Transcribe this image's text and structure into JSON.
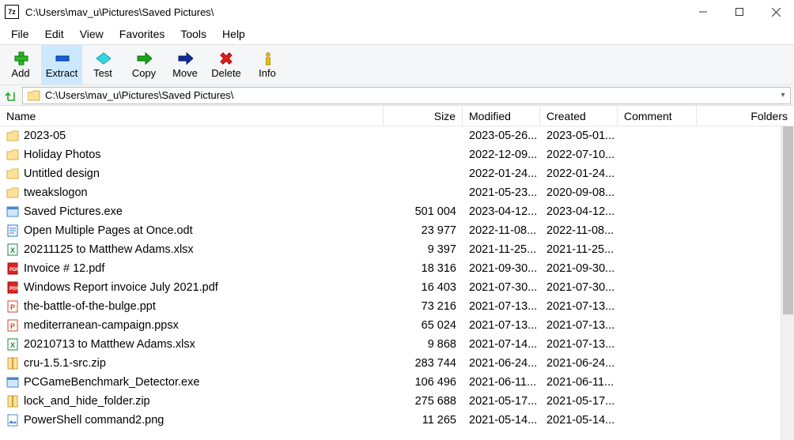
{
  "titlebar": {
    "path": "C:\\Users\\mav_u\\Pictures\\Saved Pictures\\"
  },
  "menu": [
    "File",
    "Edit",
    "View",
    "Favorites",
    "Tools",
    "Help"
  ],
  "toolbar": [
    {
      "id": "add",
      "label": "Add",
      "icon": "plus"
    },
    {
      "id": "extract",
      "label": "Extract",
      "icon": "minus",
      "selected": true
    },
    {
      "id": "test",
      "label": "Test",
      "icon": "test"
    },
    {
      "id": "copy",
      "label": "Copy",
      "icon": "arrow-right-green"
    },
    {
      "id": "move",
      "label": "Move",
      "icon": "arrow-right-blue"
    },
    {
      "id": "delete",
      "label": "Delete",
      "icon": "x-red"
    },
    {
      "id": "info",
      "label": "Info",
      "icon": "info"
    }
  ],
  "address": "C:\\Users\\mav_u\\Pictures\\Saved Pictures\\",
  "columns": {
    "name": "Name",
    "size": "Size",
    "modified": "Modified",
    "created": "Created",
    "comment": "Comment",
    "folders": "Folders"
  },
  "rows": [
    {
      "icon": "folder",
      "name": "2023-05",
      "size": "",
      "mod": "2023-05-26...",
      "cre": "2023-05-01..."
    },
    {
      "icon": "folder",
      "name": "Holiday Photos",
      "size": "",
      "mod": "2022-12-09...",
      "cre": "2022-07-10..."
    },
    {
      "icon": "folder",
      "name": "Untitled design",
      "size": "",
      "mod": "2022-01-24...",
      "cre": "2022-01-24..."
    },
    {
      "icon": "folder",
      "name": "tweakslogon",
      "size": "",
      "mod": "2021-05-23...",
      "cre": "2020-09-08..."
    },
    {
      "icon": "exe",
      "name": "Saved Pictures.exe",
      "size": "501 004",
      "mod": "2023-04-12...",
      "cre": "2023-04-12..."
    },
    {
      "icon": "odt",
      "name": "Open Multiple Pages at Once.odt",
      "size": "23 977",
      "mod": "2022-11-08...",
      "cre": "2022-11-08..."
    },
    {
      "icon": "xlsx",
      "name": "20211125 to Matthew Adams.xlsx",
      "size": "9 397",
      "mod": "2021-11-25...",
      "cre": "2021-11-25..."
    },
    {
      "icon": "pdf",
      "name": "Invoice # 12.pdf",
      "size": "18 316",
      "mod": "2021-09-30...",
      "cre": "2021-09-30..."
    },
    {
      "icon": "pdf",
      "name": "Windows Report invoice July 2021.pdf",
      "size": "16 403",
      "mod": "2021-07-30...",
      "cre": "2021-07-30..."
    },
    {
      "icon": "ppt",
      "name": "the-battle-of-the-bulge.ppt",
      "size": "73 216",
      "mod": "2021-07-13...",
      "cre": "2021-07-13..."
    },
    {
      "icon": "ppt",
      "name": "mediterranean-campaign.ppsx",
      "size": "65 024",
      "mod": "2021-07-13...",
      "cre": "2021-07-13..."
    },
    {
      "icon": "xlsx",
      "name": "20210713 to Matthew Adams.xlsx",
      "size": "9 868",
      "mod": "2021-07-14...",
      "cre": "2021-07-13..."
    },
    {
      "icon": "zip",
      "name": "cru-1.5.1-src.zip",
      "size": "283 744",
      "mod": "2021-06-24...",
      "cre": "2021-06-24..."
    },
    {
      "icon": "exe",
      "name": "PCGameBenchmark_Detector.exe",
      "size": "106 496",
      "mod": "2021-06-11...",
      "cre": "2021-06-11..."
    },
    {
      "icon": "zip",
      "name": "lock_and_hide_folder.zip",
      "size": "275 688",
      "mod": "2021-05-17...",
      "cre": "2021-05-17..."
    },
    {
      "icon": "png",
      "name": "PowerShell command2.png",
      "size": "11 265",
      "mod": "2021-05-14...",
      "cre": "2021-05-14..."
    }
  ]
}
